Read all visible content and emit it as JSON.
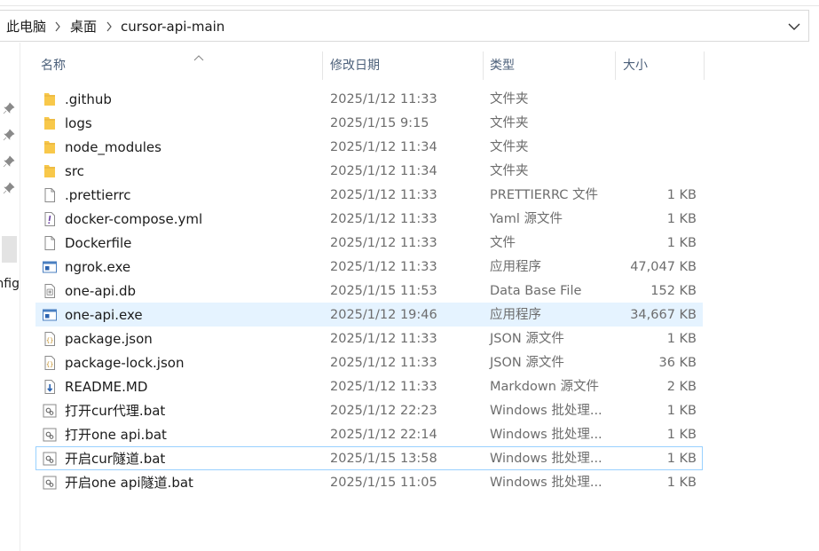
{
  "breadcrumb": {
    "items": [
      "此电脑",
      "桌面",
      "cursor-api-main"
    ],
    "separator": ">"
  },
  "nav_pane": {
    "partial_text": "nfig"
  },
  "columns": {
    "name": "名称",
    "modified": "修改日期",
    "type": "类型",
    "size": "大小"
  },
  "files": [
    {
      "name": ".github",
      "modified": "2025/1/12 11:33",
      "type": "文件夹",
      "size": "",
      "icon": "folder-icon"
    },
    {
      "name": "logs",
      "modified": "2025/1/15 9:15",
      "type": "文件夹",
      "size": "",
      "icon": "folder-icon"
    },
    {
      "name": "node_modules",
      "modified": "2025/1/12 11:34",
      "type": "文件夹",
      "size": "",
      "icon": "folder-icon"
    },
    {
      "name": "src",
      "modified": "2025/1/12 11:34",
      "type": "文件夹",
      "size": "",
      "icon": "folder-icon"
    },
    {
      "name": ".prettierrc",
      "modified": "2025/1/12 11:33",
      "type": "PRETTIERRC 文件",
      "size": "1 KB",
      "icon": "blank-file-icon"
    },
    {
      "name": "docker-compose.yml",
      "modified": "2025/1/12 11:33",
      "type": "Yaml 源文件",
      "size": "1 KB",
      "icon": "yaml-file-icon"
    },
    {
      "name": "Dockerfile",
      "modified": "2025/1/12 11:33",
      "type": "文件",
      "size": "1 KB",
      "icon": "blank-file-icon"
    },
    {
      "name": "ngrok.exe",
      "modified": "2025/1/12 11:33",
      "type": "应用程序",
      "size": "47,047 KB",
      "icon": "exe-icon"
    },
    {
      "name": "one-api.db",
      "modified": "2025/1/15 11:53",
      "type": "Data Base File",
      "size": "152 KB",
      "icon": "db-file-icon"
    },
    {
      "name": "one-api.exe",
      "modified": "2025/1/12 19:46",
      "type": "应用程序",
      "size": "34,667 KB",
      "icon": "exe-icon"
    },
    {
      "name": "package.json",
      "modified": "2025/1/12 11:33",
      "type": "JSON 源文件",
      "size": "1 KB",
      "icon": "json-file-icon"
    },
    {
      "name": "package-lock.json",
      "modified": "2025/1/12 11:33",
      "type": "JSON 源文件",
      "size": "36 KB",
      "icon": "json-file-icon"
    },
    {
      "name": "README.MD",
      "modified": "2025/1/12 11:33",
      "type": "Markdown 源文件",
      "size": "2 KB",
      "icon": "markdown-file-icon"
    },
    {
      "name": "打开cur代理.bat",
      "modified": "2025/1/12 22:23",
      "type": "Windows 批处理...",
      "size": "1 KB",
      "icon": "bat-file-icon"
    },
    {
      "name": "打开one api.bat",
      "modified": "2025/1/12 22:14",
      "type": "Windows 批处理...",
      "size": "1 KB",
      "icon": "bat-file-icon"
    },
    {
      "name": "开启cur隧道.bat",
      "modified": "2025/1/15 13:58",
      "type": "Windows 批处理...",
      "size": "1 KB",
      "icon": "bat-file-icon"
    },
    {
      "name": "开启one api隧道.bat",
      "modified": "2025/1/15 11:05",
      "type": "Windows 批处理...",
      "size": "1 KB",
      "icon": "bat-file-icon"
    }
  ],
  "state": {
    "selected_row": "one-api.exe",
    "focused_row": "开启cur隧道.bat"
  },
  "colors": {
    "folder": "#f8c84a",
    "selection": "#e5f3ff",
    "focus_border": "#99d1ff",
    "header_text": "#4c607a",
    "secondary_text": "#6d6d6d"
  }
}
